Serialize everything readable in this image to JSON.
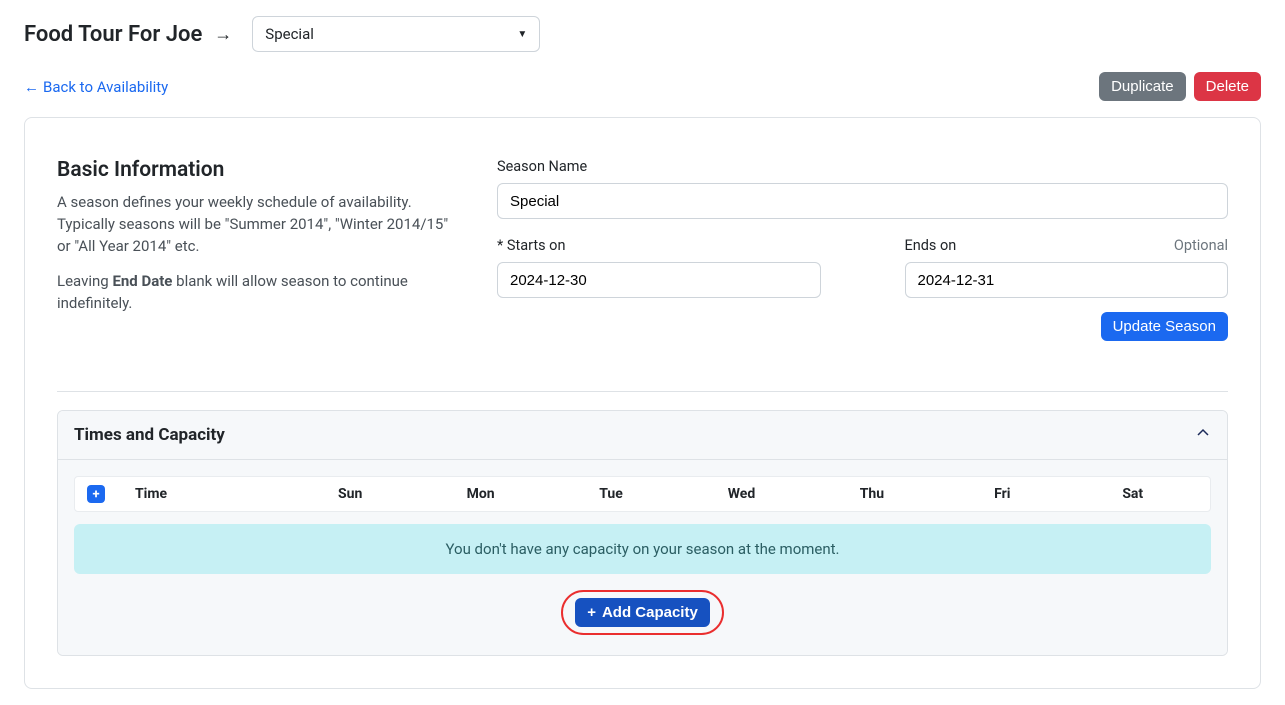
{
  "header": {
    "title": "Food Tour For Joe",
    "selected_season": "Special"
  },
  "nav": {
    "back_label": "Back to Availability"
  },
  "actions": {
    "duplicate": "Duplicate",
    "delete": "Delete"
  },
  "basic_info": {
    "heading": "Basic Information",
    "desc1": "A season defines your weekly schedule of availability. Typically seasons will be \"Summer 2014\", \"Winter 2014/15\" or \"All Year 2014\" etc.",
    "desc2_pre": "Leaving ",
    "desc2_strong": "End Date",
    "desc2_post": " blank will allow season to continue indefinitely.",
    "season_name_label": "Season Name",
    "season_name_value": "Special",
    "starts_on_label": "* Starts on",
    "starts_on_value": "2024-12-30",
    "ends_on_label": "Ends on",
    "ends_on_optional": "Optional",
    "ends_on_value": "2024-12-31",
    "update_button": "Update Season"
  },
  "times": {
    "heading": "Times and Capacity",
    "columns": {
      "time": "Time",
      "sun": "Sun",
      "mon": "Mon",
      "tue": "Tue",
      "wed": "Wed",
      "thu": "Thu",
      "fri": "Fri",
      "sat": "Sat"
    },
    "empty_message": "You don't have any capacity on your season at the moment.",
    "add_button": "Add Capacity"
  }
}
